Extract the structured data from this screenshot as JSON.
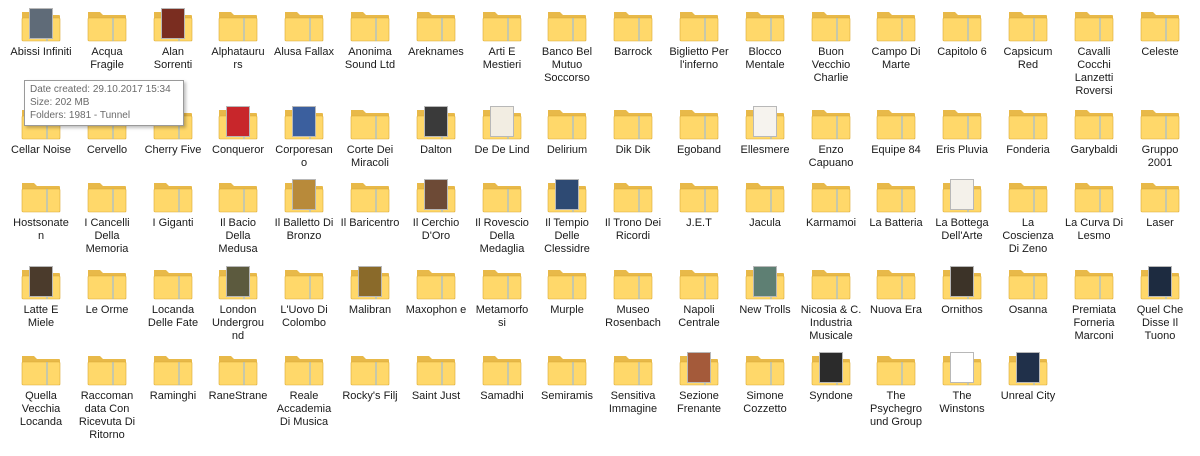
{
  "tooltip": {
    "date_created": "Date created: 29.10.2017 15:34",
    "size": "Size: 202 MB",
    "folders": "Folders: 1981 - Tunnel"
  },
  "colors": {
    "folder_back": "#e8b949",
    "folder_front": "#ffd86a",
    "folder_edge": "#d9a937",
    "label_text": "#1a1a1a"
  },
  "icon_name": "folder-icon",
  "folders": [
    {
      "name": "Abissi Infiniti",
      "cover": "#5f6b78"
    },
    {
      "name": "Acqua Fragile"
    },
    {
      "name": "Alan Sorrenti",
      "cover": "#7a2d20"
    },
    {
      "name": "Alphatauru rs"
    },
    {
      "name": "Alusa Fallax"
    },
    {
      "name": "Anonima Sound Ltd"
    },
    {
      "name": "Areknames"
    },
    {
      "name": "Arti E Mestieri"
    },
    {
      "name": "Banco Bel Mutuo Soccorso"
    },
    {
      "name": "Barrock"
    },
    {
      "name": "Biglietto Per l'inferno"
    },
    {
      "name": "Blocco Mentale"
    },
    {
      "name": "Buon Vecchio Charlie"
    },
    {
      "name": "Campo Di Marte"
    },
    {
      "name": "Capitolo 6"
    },
    {
      "name": "Capsicum Red"
    },
    {
      "name": "Cavalli Cocchi Lanzetti Roversi"
    },
    {
      "name": "Celeste"
    },
    {
      "name": "Cellar Noise"
    },
    {
      "name": "Cervello"
    },
    {
      "name": "Cherry Five"
    },
    {
      "name": "Conqueror",
      "cover": "#c8262b"
    },
    {
      "name": "Corporesan o",
      "cover": "#3b5f9e"
    },
    {
      "name": "Corte Dei Miracoli"
    },
    {
      "name": "Dalton",
      "cover": "#3a3a3a"
    },
    {
      "name": "De De Lind",
      "cover": "#f2ede2"
    },
    {
      "name": "Delirium"
    },
    {
      "name": "Dik Dik"
    },
    {
      "name": "Egoband"
    },
    {
      "name": "Ellesmere",
      "cover": "#f6f3ee"
    },
    {
      "name": "Enzo Capuano"
    },
    {
      "name": "Equipe 84"
    },
    {
      "name": "Eris Pluvia"
    },
    {
      "name": "Fonderia"
    },
    {
      "name": "Garybaldi"
    },
    {
      "name": "Gruppo 2001"
    },
    {
      "name": "Hostsonate n"
    },
    {
      "name": "I Cancelli Della Memoria"
    },
    {
      "name": "I Giganti"
    },
    {
      "name": "Il Bacio Della Medusa"
    },
    {
      "name": "Il Balletto Di Bronzo",
      "cover": "#b88a3a"
    },
    {
      "name": "Il Baricentro"
    },
    {
      "name": "Il Cerchio D'Oro",
      "cover": "#6d4a36"
    },
    {
      "name": "Il Rovescio Della Medaglia"
    },
    {
      "name": "Il Tempio Delle Clessidre",
      "cover": "#2e4a73"
    },
    {
      "name": "Il Trono Dei Ricordi"
    },
    {
      "name": "J.E.T"
    },
    {
      "name": "Jacula"
    },
    {
      "name": "Karmamoi"
    },
    {
      "name": "La Batteria"
    },
    {
      "name": "La Bottega Dell'Arte",
      "cover": "#f4f1ea"
    },
    {
      "name": "La Coscienza Di Zeno"
    },
    {
      "name": "La Curva Di Lesmo"
    },
    {
      "name": "Laser"
    },
    {
      "name": "Latte E Miele",
      "cover": "#4b3b2c"
    },
    {
      "name": "Le Orme"
    },
    {
      "name": "Locanda Delle Fate"
    },
    {
      "name": "London Undergrou nd",
      "cover": "#5c5a3e"
    },
    {
      "name": "L'Uovo Di Colombo"
    },
    {
      "name": "Malibran",
      "cover": "#8a6a2a"
    },
    {
      "name": "Maxophon e"
    },
    {
      "name": "Metamorfo si"
    },
    {
      "name": "Murple"
    },
    {
      "name": "Museo Rosenbach"
    },
    {
      "name": "Napoli Centrale"
    },
    {
      "name": "New Trolls",
      "cover": "#5e7f73"
    },
    {
      "name": "Nicosia & C. Industria Musicale"
    },
    {
      "name": "Nuova Era"
    },
    {
      "name": "Ornithos",
      "cover": "#3c3328"
    },
    {
      "name": "Osanna"
    },
    {
      "name": "Premiata Forneria Marconi"
    },
    {
      "name": "Quel Che Disse Il Tuono",
      "cover": "#1d2b40"
    },
    {
      "name": "Quella Vecchia Locanda"
    },
    {
      "name": "Raccoman data Con Ricevuta Di Ritorno"
    },
    {
      "name": "Raminghi"
    },
    {
      "name": "RaneStrane"
    },
    {
      "name": "Reale Accademia Di Musica"
    },
    {
      "name": "Rocky's Filj"
    },
    {
      "name": "Saint Just"
    },
    {
      "name": "Samadhi"
    },
    {
      "name": "Semiramis"
    },
    {
      "name": "Sensitiva Immagine"
    },
    {
      "name": "Sezione Frenante",
      "cover": "#a45a3a"
    },
    {
      "name": "Simone Cozzetto"
    },
    {
      "name": "Syndone",
      "cover": "#2b2b2b"
    },
    {
      "name": "The Psychegro und Group"
    },
    {
      "name": "The Winstons",
      "cover": "#ffffff"
    },
    {
      "name": "Unreal City",
      "cover": "#20304a"
    }
  ]
}
